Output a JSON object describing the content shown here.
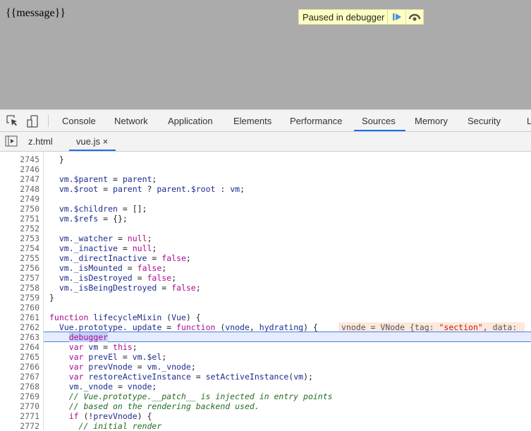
{
  "page": {
    "message": "{{message}}",
    "paused_label": "Paused in debugger",
    "resume_icon": "resume-icon",
    "step_over_icon": "step-over-icon"
  },
  "toolbar": {
    "tabs": [
      "Console",
      "Network",
      "Application",
      "Elements",
      "Performance",
      "Sources",
      "Memory",
      "Security",
      "L"
    ],
    "selected": "Sources"
  },
  "file_tabs": {
    "files": [
      "z.html",
      "vue.js"
    ],
    "close": "×",
    "selected": "vue.js"
  },
  "code": {
    "highlighted_line": "2763",
    "inline_value": {
      "name": "vnode = VNode {",
      "key": "tag: ",
      "str": "\"section\"",
      "rest": ", data: "
    },
    "lines": [
      {
        "n": "2745",
        "t": [
          [
            "pl",
            "  }"
          ]
        ]
      },
      {
        "n": "2746",
        "t": []
      },
      {
        "n": "2747",
        "t": [
          [
            "id",
            "  vm.$parent "
          ],
          [
            "pl",
            "= "
          ],
          [
            "id",
            "parent"
          ],
          [
            "pl",
            ";"
          ]
        ]
      },
      {
        "n": "2748",
        "t": [
          [
            "id",
            "  vm.$root "
          ],
          [
            "pl",
            "= "
          ],
          [
            "id",
            "parent "
          ],
          [
            "pl",
            "? "
          ],
          [
            "id",
            "parent.$root "
          ],
          [
            "pl",
            ": "
          ],
          [
            "id",
            "vm"
          ],
          [
            "pl",
            ";"
          ]
        ]
      },
      {
        "n": "2749",
        "t": []
      },
      {
        "n": "2750",
        "t": [
          [
            "id",
            "  vm.$children "
          ],
          [
            "pl",
            "= [];"
          ]
        ]
      },
      {
        "n": "2751",
        "t": [
          [
            "id",
            "  vm.$refs "
          ],
          [
            "pl",
            "= {};"
          ]
        ]
      },
      {
        "n": "2752",
        "t": []
      },
      {
        "n": "2753",
        "t": [
          [
            "id",
            "  vm._watcher "
          ],
          [
            "pl",
            "= "
          ],
          [
            "kw",
            "null"
          ],
          [
            "pl",
            ";"
          ]
        ]
      },
      {
        "n": "2754",
        "t": [
          [
            "id",
            "  vm._inactive "
          ],
          [
            "pl",
            "= "
          ],
          [
            "kw",
            "null"
          ],
          [
            "pl",
            ";"
          ]
        ]
      },
      {
        "n": "2755",
        "t": [
          [
            "id",
            "  vm._directInactive "
          ],
          [
            "pl",
            "= "
          ],
          [
            "kw",
            "false"
          ],
          [
            "pl",
            ";"
          ]
        ]
      },
      {
        "n": "2756",
        "t": [
          [
            "id",
            "  vm._isMounted "
          ],
          [
            "pl",
            "= "
          ],
          [
            "kw",
            "false"
          ],
          [
            "pl",
            ";"
          ]
        ]
      },
      {
        "n": "2757",
        "t": [
          [
            "id",
            "  vm._isDestroyed "
          ],
          [
            "pl",
            "= "
          ],
          [
            "kw",
            "false"
          ],
          [
            "pl",
            ";"
          ]
        ]
      },
      {
        "n": "2758",
        "t": [
          [
            "id",
            "  vm._isBeingDestroyed "
          ],
          [
            "pl",
            "= "
          ],
          [
            "kw",
            "false"
          ],
          [
            "pl",
            ";"
          ]
        ]
      },
      {
        "n": "2759",
        "t": [
          [
            "pl",
            "}"
          ]
        ]
      },
      {
        "n": "2760",
        "t": []
      },
      {
        "n": "2761",
        "t": [
          [
            "kw",
            "function "
          ],
          [
            "id",
            "lifecycleMixin "
          ],
          [
            "pl",
            "("
          ],
          [
            "id",
            "Vue"
          ],
          [
            "pl",
            ") {"
          ]
        ]
      },
      {
        "n": "2762",
        "t": [
          [
            "id",
            "  Vue.prototype._update "
          ],
          [
            "pl",
            "= "
          ],
          [
            "kw",
            "function "
          ],
          [
            "pl",
            "("
          ],
          [
            "id",
            "vnode"
          ],
          [
            "pl",
            ", "
          ],
          [
            "id",
            "hydrating"
          ],
          [
            "pl",
            ") {"
          ]
        ]
      },
      {
        "n": "2763",
        "t": [
          [
            "pl",
            "    "
          ],
          [
            "dbg",
            "debugger"
          ]
        ]
      },
      {
        "n": "2764",
        "t": [
          [
            "kw",
            "    var "
          ],
          [
            "id",
            "vm "
          ],
          [
            "pl",
            "= "
          ],
          [
            "kw",
            "this"
          ],
          [
            "pl",
            ";"
          ]
        ]
      },
      {
        "n": "2765",
        "t": [
          [
            "kw",
            "    var "
          ],
          [
            "id",
            "prevEl "
          ],
          [
            "pl",
            "= "
          ],
          [
            "id",
            "vm.$el"
          ],
          [
            "pl",
            ";"
          ]
        ]
      },
      {
        "n": "2766",
        "t": [
          [
            "kw",
            "    var "
          ],
          [
            "id",
            "prevVnode "
          ],
          [
            "pl",
            "= "
          ],
          [
            "id",
            "vm._vnode"
          ],
          [
            "pl",
            ";"
          ]
        ]
      },
      {
        "n": "2767",
        "t": [
          [
            "kw",
            "    var "
          ],
          [
            "id",
            "restoreActiveInstance "
          ],
          [
            "pl",
            "= "
          ],
          [
            "id",
            "setActiveInstance"
          ],
          [
            "pl",
            "("
          ],
          [
            "id",
            "vm"
          ],
          [
            "pl",
            ");"
          ]
        ]
      },
      {
        "n": "2768",
        "t": [
          [
            "id",
            "    vm._vnode "
          ],
          [
            "pl",
            "= "
          ],
          [
            "id",
            "vnode"
          ],
          [
            "pl",
            ";"
          ]
        ]
      },
      {
        "n": "2769",
        "t": [
          [
            "cm",
            "    // Vue.prototype.__patch__ is injected in entry points"
          ]
        ]
      },
      {
        "n": "2770",
        "t": [
          [
            "cm",
            "    // based on the rendering backend used."
          ]
        ]
      },
      {
        "n": "2771",
        "t": [
          [
            "kw",
            "    if "
          ],
          [
            "pl",
            "(!"
          ],
          [
            "id",
            "prevVnode"
          ],
          [
            "pl",
            ") {"
          ]
        ]
      },
      {
        "n": "2772",
        "t": [
          [
            "cm",
            "      // initial render"
          ]
        ]
      }
    ]
  }
}
